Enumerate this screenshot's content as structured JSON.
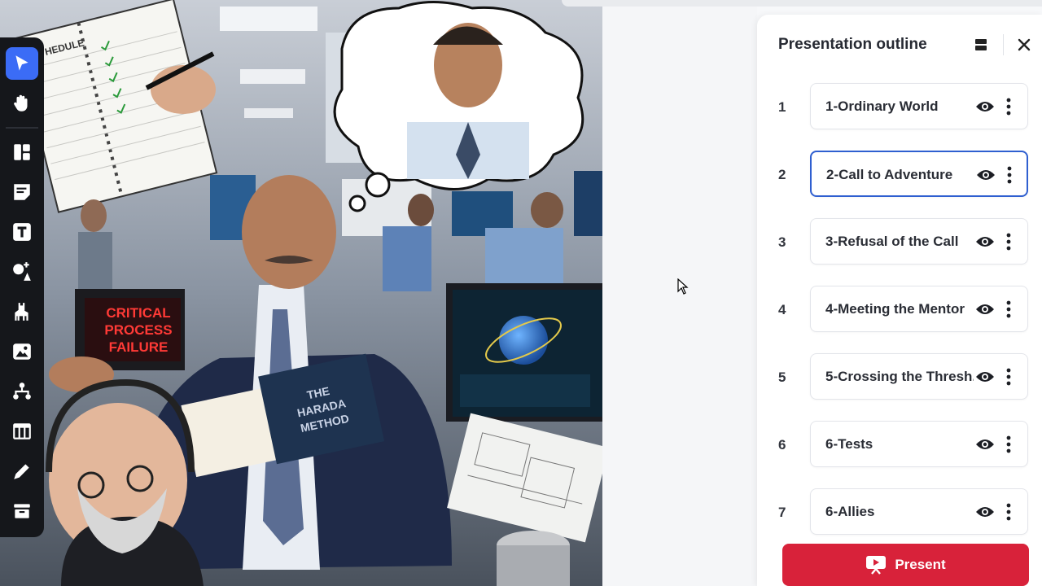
{
  "slide_image": {
    "alt_scene": "office-stress-illustration",
    "headline_screen": "CRITICAL\nPROCESS\nFAILURE",
    "book_title": "THE\nHARADA\nMETHOD",
    "notebook_label": "HEDULE"
  },
  "toolbar": {
    "tools": [
      "select-icon",
      "hand-icon",
      "layout-icon",
      "sticky-note-icon",
      "text-icon",
      "shapes-icon",
      "llama-icon",
      "image-icon",
      "diagram-icon",
      "table-icon",
      "pen-icon",
      "archive-icon"
    ]
  },
  "outline": {
    "title": "Presentation outline",
    "slides": [
      {
        "num": "1",
        "label": "1-Ordinary World"
      },
      {
        "num": "2",
        "label": "2-Call to Adventure"
      },
      {
        "num": "3",
        "label": "3-Refusal of the Call"
      },
      {
        "num": "4",
        "label": "4-Meeting the Mentor"
      },
      {
        "num": "5",
        "label": "5-Crossing the Thresh..."
      },
      {
        "num": "6",
        "label": "6-Tests"
      },
      {
        "num": "7",
        "label": "6-Allies"
      }
    ],
    "present_label": "Present"
  },
  "colors": {
    "accent": "#3b6cf6",
    "present": "#d8223a",
    "selected_border": "#2f5fd0"
  }
}
